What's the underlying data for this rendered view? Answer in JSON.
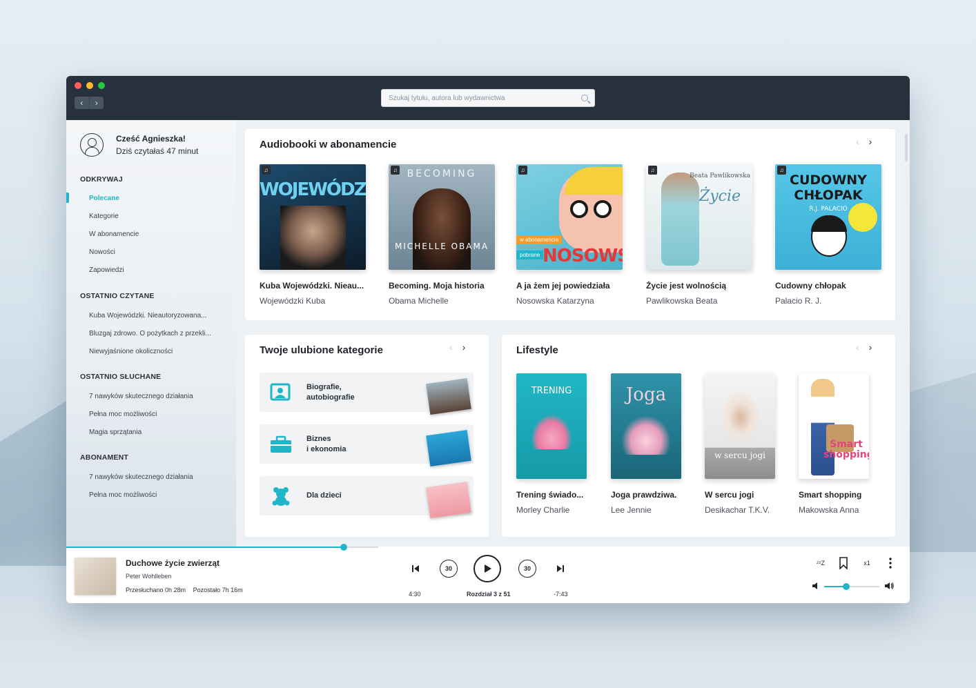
{
  "search": {
    "placeholder": "Szukaj tytułu, autora lub wydawnictwa"
  },
  "user": {
    "greeting": "Cześć Agnieszka!",
    "subtitle": "Dziś czytałaś 47 minut"
  },
  "sidebar": {
    "sections": [
      {
        "title": "ODKRYWAJ",
        "items": [
          "Polecane",
          "Kategorie",
          "W abonamencie",
          "Nowości",
          "Zapowiedzi"
        ]
      },
      {
        "title": "OSTATNIO CZYTANE",
        "items": [
          "Kuba Wojewódzki. Nieautoryzowana...",
          "Bluzgaj zdrowo. O pożytkach z przekli...",
          "Niewyjaśnione okoliczności"
        ]
      },
      {
        "title": "OSTATNIO SŁUCHANE",
        "items": [
          "7 nawyków skutecznego działania",
          "Pełna moc możliwości",
          "Magia sprzątania"
        ]
      },
      {
        "title": "ABONAMENT",
        "items": [
          "7 nawyków skutecznego działania",
          "Pełna moc możliwości"
        ]
      }
    ],
    "active_item": "Polecane"
  },
  "audiobooks": {
    "title": "Audiobooki w abonamencie",
    "books": [
      {
        "title": "Kuba Wojewódzki. Nieau...",
        "author": "Wojewódzki Kuba",
        "cover_text": "WOJEWÓDZKI",
        "colors": [
          "#1b3f5e",
          "#0a1a28"
        ]
      },
      {
        "title": "Becoming. Moja historia",
        "author": "Obama Michelle",
        "cover_text": "BECOMING",
        "cover_sub": "MICHELLE OBAMA",
        "colors": [
          "#8fa6b3",
          "#5f7683"
        ]
      },
      {
        "title": "A ja żem jej powiedziała",
        "author": "Nosowska Katarzyna",
        "cover_text": "NOSOWSKA",
        "badge1": "w abonamencie",
        "badge2": "pobrane",
        "colors": [
          "#6fc7dc",
          "#4fb5cc"
        ]
      },
      {
        "title": "Życie jest wolnością",
        "author": "Pawlikowska Beata",
        "cover_text": "Życie",
        "cover_sub": "Beata Pawlikowska",
        "colors": [
          "#eef3f4",
          "#d5e3e7"
        ]
      },
      {
        "title": "Cudowny chłopak",
        "author": "Palacio R. J.",
        "cover_text": "CUDOWNY CHŁOPAK",
        "cover_sub": "R.J. PALACIO",
        "colors": [
          "#4fc3e6",
          "#3aaed4"
        ]
      }
    ]
  },
  "categories": {
    "title": "Twoje ulubione kategorie",
    "items": [
      {
        "line1": "Biografie,",
        "line2": "autobiografie"
      },
      {
        "line1": "Biznes",
        "line2": "i ekonomia"
      },
      {
        "line1": "Dla dzieci",
        "line2": ""
      }
    ]
  },
  "lifestyle": {
    "title": "Lifestyle",
    "books": [
      {
        "title": "Trening świado...",
        "author": "Morley Charlie",
        "cover_text": "TRENING",
        "colors": [
          "#1fb4c3",
          "#17a0ae"
        ]
      },
      {
        "title": "Joga prawdziwa.",
        "author": "Lee Jennie",
        "cover_text": "Joga",
        "colors": [
          "#2a8aa0",
          "#1c6d80"
        ]
      },
      {
        "title": "W sercu jogi",
        "author": "Desikachar T.K.V.",
        "cover_text": "w sercu jogi",
        "colors": [
          "#f2f2f2",
          "#bcbcbc"
        ]
      },
      {
        "title": "Smart shopping",
        "author": "Makowska Anna",
        "cover_text": "Smart shopping",
        "colors": [
          "#ffffff",
          "#f1f1f1"
        ]
      }
    ]
  },
  "player": {
    "title": "Duchowe życie zwierząt",
    "author": "Peter Wohlleben",
    "listened": "Przesłuchano 0h 28m",
    "remaining": "Pozostało 7h 16m",
    "elapsed": "4:30",
    "chapter": "Rozdział 3 z 51",
    "left": "-7:43",
    "skip_back": "30",
    "skip_forward": "30",
    "speed": "x1",
    "progress": 0.89,
    "volume": 0.4
  },
  "accent": "#1fb6c9"
}
